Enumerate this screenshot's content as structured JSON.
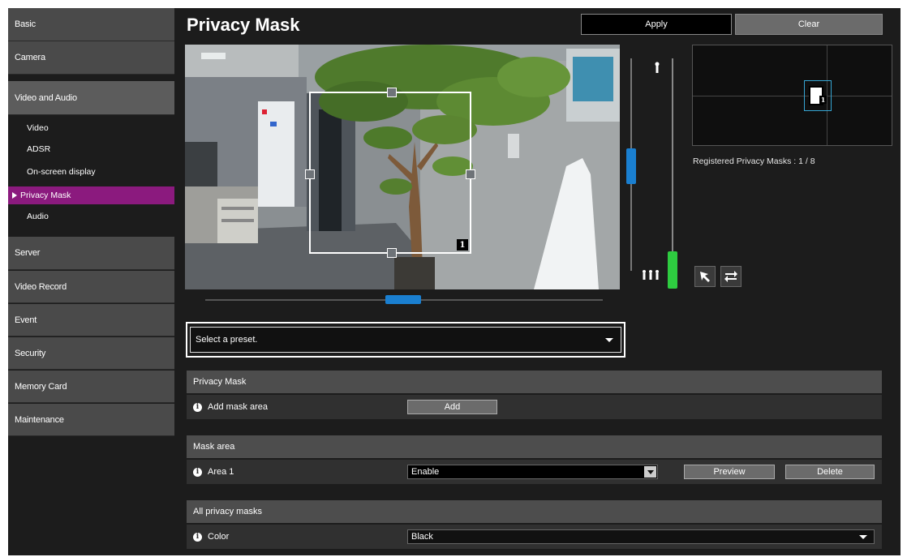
{
  "sidebar": {
    "items": [
      {
        "label": "Basic"
      },
      {
        "label": "Camera"
      },
      {
        "label": "Video and Audio"
      },
      {
        "label": "Server"
      },
      {
        "label": "Video Record"
      },
      {
        "label": "Event"
      },
      {
        "label": "Security"
      },
      {
        "label": "Memory Card"
      },
      {
        "label": "Maintenance"
      }
    ],
    "sub_items": [
      {
        "label": "Video"
      },
      {
        "label": "ADSR"
      },
      {
        "label": "On-screen display"
      },
      {
        "label": "Privacy Mask"
      },
      {
        "label": "Audio"
      }
    ]
  },
  "header": {
    "title": "Privacy Mask",
    "apply_label": "Apply",
    "clear_label": "Clear"
  },
  "camera": {
    "mask_number": "1"
  },
  "overview": {
    "mask_number": "1"
  },
  "registered_masks": "Registered Privacy Masks : 1 / 8",
  "preset": {
    "selected": "Select a preset."
  },
  "sections": {
    "privacy_mask": {
      "title": "Privacy Mask",
      "add_label": "Add mask area",
      "add_button": "Add"
    },
    "mask_area": {
      "title": "Mask area",
      "area_label": "Area 1",
      "area_value": "Enable",
      "preview_button": "Preview",
      "delete_button": "Delete"
    },
    "all_masks": {
      "title": "All privacy masks",
      "color_label": "Color",
      "color_value": "Black"
    }
  },
  "icons": {
    "info": "i"
  },
  "colors": {
    "active_nav": "#8b1a7e",
    "slider_blue": "#1a7fd0",
    "zoom_green": "#2ecc40",
    "frame_cyan": "#36a6d4"
  }
}
